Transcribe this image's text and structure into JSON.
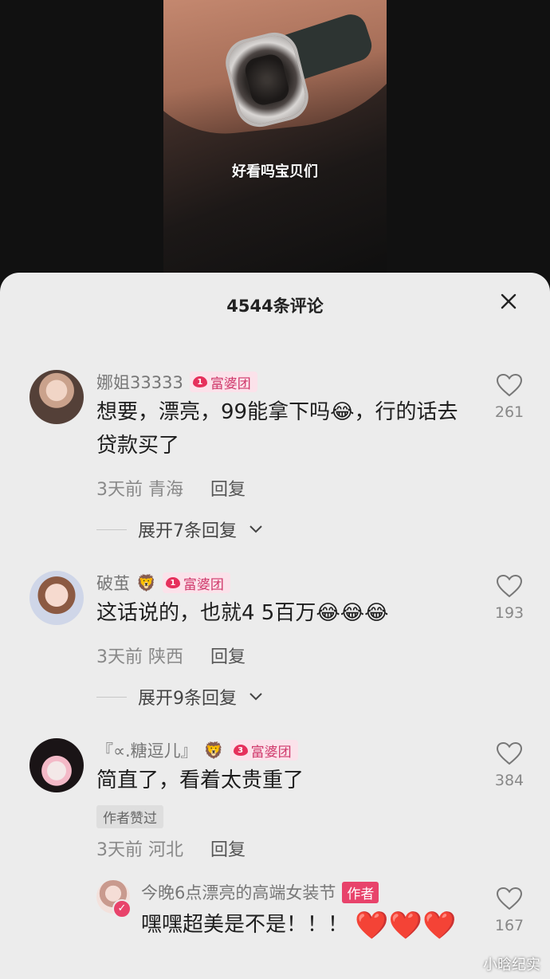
{
  "video": {
    "caption": "好看吗宝贝们"
  },
  "sheet": {
    "title": "4544条评论",
    "close_icon": "close-icon"
  },
  "comments": [
    {
      "username": "娜姐33333",
      "badge_level": "1",
      "badge_label": "富婆团",
      "content": "想要，漂亮，99能拿下吗😂，行的话去贷款买了",
      "time": "3天前",
      "location": "青海",
      "reply_label": "回复",
      "expand_label": "展开7条回复",
      "likes": "261"
    },
    {
      "username": "破茧",
      "name_emoji": "🦁",
      "badge_level": "1",
      "badge_label": "富婆团",
      "content": "这话说的，也就4  5百万😂😂😂",
      "time": "3天前",
      "location": "陕西",
      "reply_label": "回复",
      "expand_label": "展开9条回复",
      "likes": "193"
    },
    {
      "username": "『∝.糖逗儿』",
      "name_emoji": "🦁",
      "badge_level": "3",
      "badge_label": "富婆团",
      "content": "简直了，看着太贵重了",
      "author_liked": "作者赞过",
      "time": "3天前",
      "location": "河北",
      "reply_label": "回复",
      "likes": "384",
      "reply": {
        "username": "今晚6点漂亮的高端女装节",
        "author_tag": "作者",
        "content": "嘿嘿超美是不是！！！",
        "hearts": "❤️❤️❤️",
        "likes": "167"
      }
    }
  ],
  "watermark": "小晗纪实"
}
